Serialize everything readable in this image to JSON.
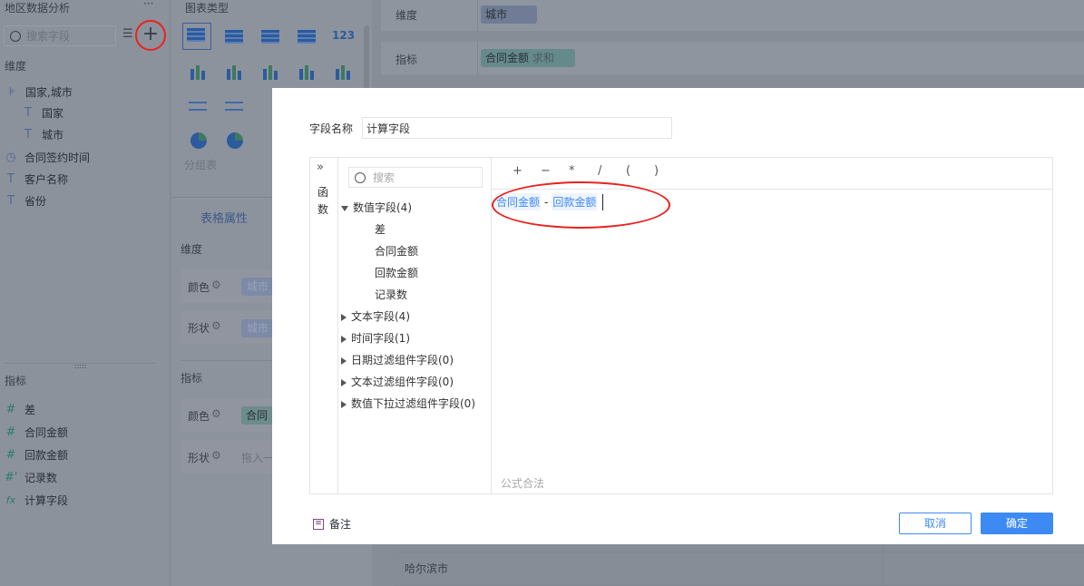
{
  "left_panel": {
    "title": "地区数据分析",
    "more": "···",
    "search_placeholder": "搜索字段",
    "dimension_header": "维度",
    "dimensions": [
      {
        "label": "国家,城市",
        "icon": "hierarchy-icon"
      },
      {
        "label": "国家",
        "icon": "text-icon"
      },
      {
        "label": "城市",
        "icon": "text-icon"
      },
      {
        "label": "合同签约时间",
        "icon": "clock-icon"
      },
      {
        "label": "客户名称",
        "icon": "text-icon"
      },
      {
        "label": "省份",
        "icon": "text-icon"
      }
    ],
    "metric_header": "指标",
    "metrics": [
      {
        "label": "差",
        "icon": "number-icon"
      },
      {
        "label": "合同金额",
        "icon": "number-icon"
      },
      {
        "label": "回款金额",
        "icon": "number-icon"
      },
      {
        "label": "记录数",
        "icon": "number-icon"
      },
      {
        "label": "计算字段",
        "icon": "fx-icon"
      }
    ]
  },
  "mid_panel": {
    "chart_type_title": "图表类型",
    "group_table_label": "分组表",
    "table_props_tab": "表格属性",
    "dimension_header": "维度",
    "color_label": "颜色",
    "shape_label": "形状",
    "dim_color_chip": "城市",
    "dim_shape_chip": "城市",
    "metric_header": "指标",
    "metric_color_chip": "合同金",
    "metric_shape_placeholder": "拖入一"
  },
  "right_panel": {
    "dimension_label": "维度",
    "dimension_chip": "城市",
    "metric_label": "指标",
    "metric_chip": "合同金额",
    "metric_agg": "求和",
    "table_cell": "哈尔滨市"
  },
  "modal": {
    "field_name_label": "字段名称",
    "field_name_value": "计算字段",
    "function_tab": "函数",
    "function_tab_chars": [
      "函",
      "数"
    ],
    "search_placeholder": "搜索",
    "tree": [
      {
        "label": "数值字段(4)",
        "expanded": true,
        "children": [
          "差",
          "合同金额",
          "回款金额",
          "记录数"
        ]
      },
      {
        "label": "文本字段(4)",
        "expanded": false
      },
      {
        "label": "时间字段(1)",
        "expanded": false
      },
      {
        "label": "日期过滤组件字段(0)",
        "expanded": false
      },
      {
        "label": "文本过滤组件字段(0)",
        "expanded": false
      },
      {
        "label": "数值下拉过滤组件字段(0)",
        "expanded": false
      }
    ],
    "operators": [
      "+",
      "−",
      "*",
      "/",
      "(",
      ")"
    ],
    "formula": {
      "token1": "合同金额",
      "op": "-",
      "token2": "回款金额"
    },
    "status": "公式合法",
    "note_label": "备注",
    "cancel": "取消",
    "confirm": "确定"
  },
  "colors": {
    "accent": "#3d8af5",
    "annotation_red": "#e8231e",
    "overlay": "#8b919b"
  }
}
